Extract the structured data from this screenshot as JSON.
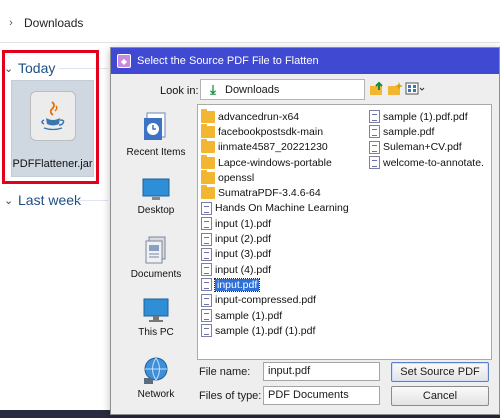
{
  "explorer": {
    "breadcrumb": "Downloads",
    "groups": {
      "today": "Today",
      "last_week": "Last week"
    },
    "selected_file": "PDFFlattener.jar"
  },
  "dialog": {
    "title": "Select the Source PDF File to Flatten",
    "look_in_label": "Look in:",
    "look_in_value": "Downloads",
    "places": [
      "Recent Items",
      "Desktop",
      "Documents",
      "This PC",
      "Network"
    ],
    "files_col1": [
      {
        "name": "advancedrun-x64",
        "kind": "folder"
      },
      {
        "name": "facebookpostsdk-main",
        "kind": "folder"
      },
      {
        "name": "iinmate4587_20221230",
        "kind": "folder"
      },
      {
        "name": "Lapce-windows-portable",
        "kind": "folder"
      },
      {
        "name": "openssl",
        "kind": "folder"
      },
      {
        "name": "SumatraPDF-3.4.6-64",
        "kind": "folder"
      },
      {
        "name": "Hands On Machine Learning",
        "kind": "doc"
      },
      {
        "name": "input (1).pdf",
        "kind": "doc"
      },
      {
        "name": "input (2).pdf",
        "kind": "doc"
      },
      {
        "name": "input (3).pdf",
        "kind": "doc"
      },
      {
        "name": "input (4).pdf",
        "kind": "doc"
      },
      {
        "name": "input.pdf",
        "kind": "doc",
        "selected": true
      },
      {
        "name": "input-compressed.pdf",
        "kind": "doc"
      },
      {
        "name": "sample (1).pdf",
        "kind": "doc"
      },
      {
        "name": "sample (1).pdf (1).pdf",
        "kind": "doc"
      }
    ],
    "files_col2": [
      {
        "name": "sample (1).pdf.pdf",
        "kind": "doc"
      },
      {
        "name": "sample.pdf",
        "kind": "doc"
      },
      {
        "name": "Suleman+CV.pdf",
        "kind": "doc"
      },
      {
        "name": "welcome-to-annotate.",
        "kind": "doc"
      }
    ],
    "file_name_label": "File name:",
    "file_name_value": "input.pdf",
    "files_of_type_label": "Files of type:",
    "files_of_type_value": "PDF Documents",
    "primary_button": "Set Source PDF",
    "cancel_button": "Cancel"
  },
  "colors": {
    "titlebar": "#3f49d1",
    "highlight_box": "#e2001a",
    "selection": "#2f6fd8",
    "group_header": "#1f4f86",
    "folder": "#f3b632"
  },
  "icons": {
    "title": "jar-app-icon",
    "look_in": "download-arrow-icon",
    "up_folder": "up-folder-icon",
    "new_folder": "new-folder-icon",
    "view_menu": "view-list-icon"
  }
}
